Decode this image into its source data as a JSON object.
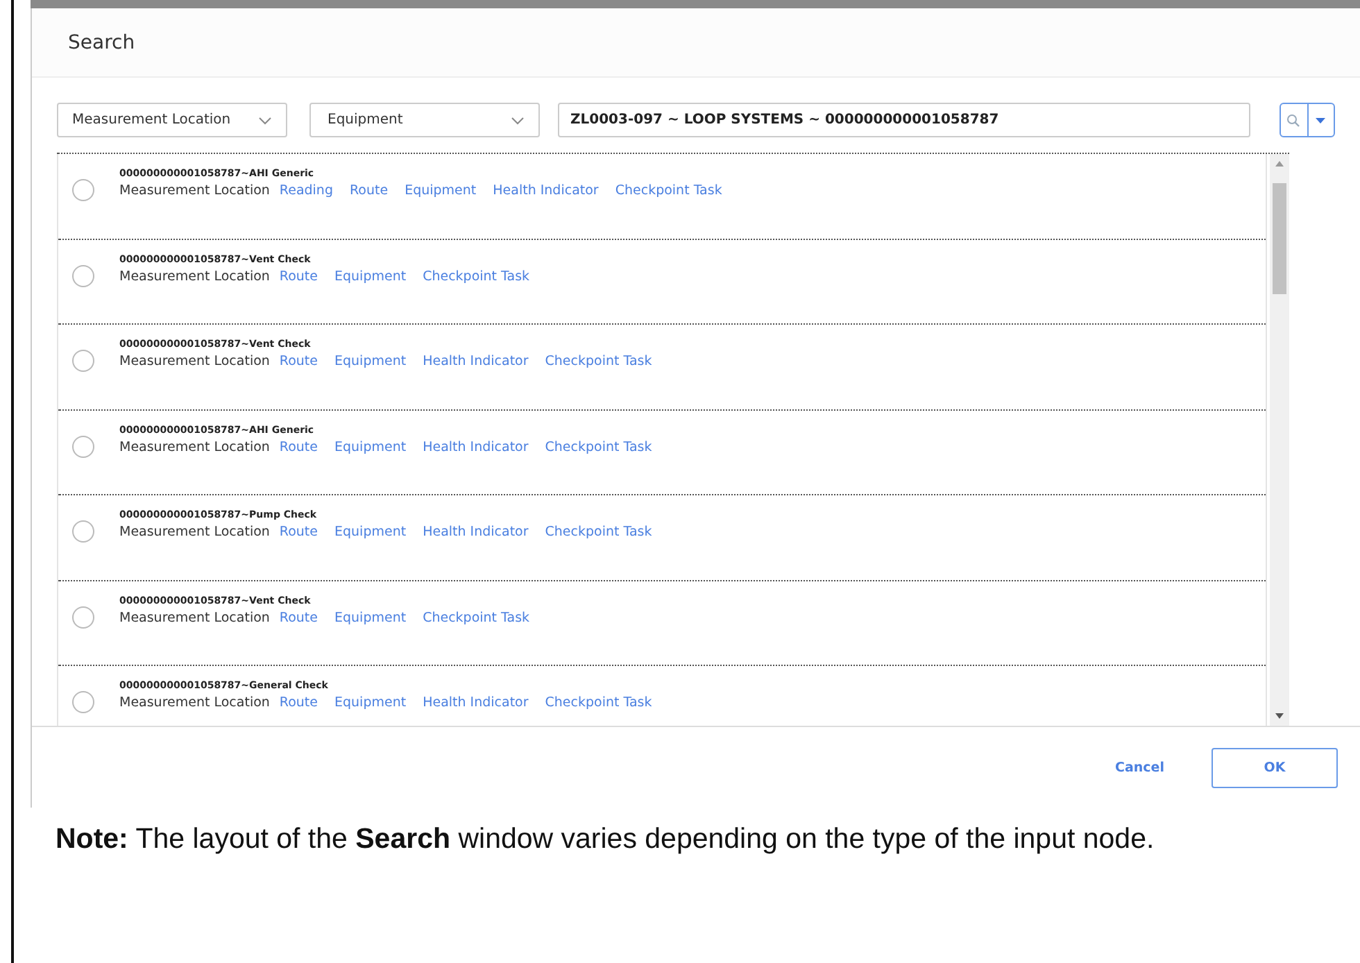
{
  "dialog": {
    "title": "Search",
    "filters": [
      {
        "value": "Measurement Location"
      },
      {
        "value": "Equipment"
      }
    ],
    "query": {
      "value": "ZL0003-097 ~ LOOP SYSTEMS ~ 000000000001058787"
    },
    "results": [
      {
        "title": "000000000001058787~AHI Generic",
        "type": "Measurement Location",
        "links": [
          "Reading",
          "Route",
          "Equipment",
          "Health Indicator",
          "Checkpoint Task"
        ],
        "selected": false
      },
      {
        "title": "000000000001058787~Vent Check",
        "type": "Measurement Location",
        "links": [
          "Route",
          "Equipment",
          "Checkpoint Task"
        ],
        "selected": false
      },
      {
        "title": "000000000001058787~Vent Check",
        "type": "Measurement Location",
        "links": [
          "Route",
          "Equipment",
          "Health Indicator",
          "Checkpoint Task"
        ],
        "selected": false
      },
      {
        "title": "000000000001058787~AHI Generic",
        "type": "Measurement Location",
        "links": [
          "Route",
          "Equipment",
          "Health Indicator",
          "Checkpoint Task"
        ],
        "selected": false
      },
      {
        "title": "000000000001058787~Pump Check",
        "type": "Measurement Location",
        "links": [
          "Route",
          "Equipment",
          "Health Indicator",
          "Checkpoint Task"
        ],
        "selected": false
      },
      {
        "title": "000000000001058787~Vent Check",
        "type": "Measurement Location",
        "links": [
          "Route",
          "Equipment",
          "Checkpoint Task"
        ],
        "selected": false
      },
      {
        "title": "000000000001058787~General Check",
        "type": "Measurement Location",
        "links": [
          "Route",
          "Equipment",
          "Health Indicator",
          "Checkpoint Task"
        ],
        "selected": false
      }
    ],
    "buttons": [
      {
        "label": "Cancel",
        "kind": "text"
      },
      {
        "label": "OK",
        "kind": "outlined"
      }
    ]
  },
  "note": "**Note:** The layout of the **Search** window varies depending on the type of the input node."
}
